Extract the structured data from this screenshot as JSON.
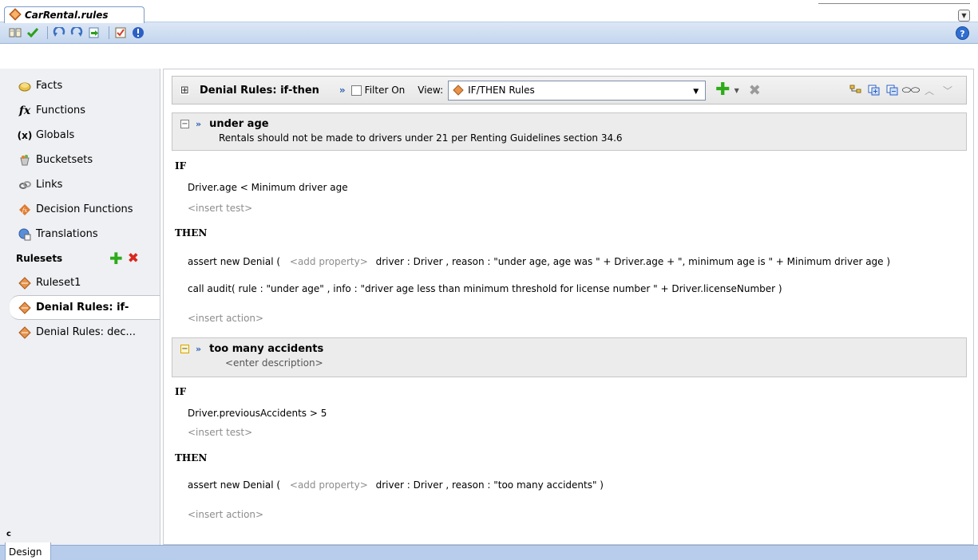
{
  "file_tab": {
    "label": "CarRental.rules"
  },
  "toolbar": {
    "icons": [
      "book-icon",
      "validate-check-icon",
      "undo-icon",
      "redo-icon",
      "import-icon",
      "report-icon",
      "info-icon"
    ],
    "help_label": "?"
  },
  "sidebar": {
    "items": [
      {
        "label": "Facts",
        "icon": "facts-icon"
      },
      {
        "label": "Functions",
        "icon": "functions-icon"
      },
      {
        "label": "Globals",
        "icon": "globals-icon"
      },
      {
        "label": "Bucketsets",
        "icon": "bucketsets-icon"
      },
      {
        "label": "Links",
        "icon": "links-icon"
      },
      {
        "label": "Decision Functions",
        "icon": "decision-functions-icon"
      },
      {
        "label": "Translations",
        "icon": "translations-icon"
      }
    ],
    "rulesets_header": "Rulesets",
    "rulesets": [
      {
        "label": "Ruleset1",
        "selected": false
      },
      {
        "label": "Denial Rules: if-",
        "selected": true
      },
      {
        "label": "Denial Rules: dec...",
        "selected": false
      }
    ],
    "collapse_glyph": "ⅽ"
  },
  "ruleset_header": {
    "toggle": "⊞",
    "title": "Denial Rules: if-then",
    "filter_label": "Filter On",
    "view_label": "View:",
    "view_value": "IF/THEN Rules"
  },
  "rules": [
    {
      "name": "under age",
      "description": "Rentals should not be made to drivers under 21 per Renting Guidelines section 34.6",
      "if_keyword": "IF",
      "tests": [
        "Driver.age  <  Minimum driver age"
      ],
      "insert_test": "<insert test>",
      "then_keyword": "THEN",
      "actions": [
        {
          "prefix": "assert new Denial (",
          "placeholder": "<add property>",
          "rest": "driver : Driver , reason : \"under age, age was \" + Driver.age + \", minimum age is \" + Minimum driver age  )"
        },
        {
          "prefix": "call audit( rule : \"under age\" , info : \"driver age less than minimum threshold for license number \" + Driver.licenseNumber )",
          "placeholder": "",
          "rest": ""
        }
      ],
      "insert_action": "<insert action>"
    },
    {
      "name": "too many accidents",
      "description": "<enter description>",
      "if_keyword": "IF",
      "tests": [
        "Driver.previousAccidents  >  5"
      ],
      "insert_test": "<insert test>",
      "then_keyword": "THEN",
      "actions": [
        {
          "prefix": "assert new Denial (",
          "placeholder": "<add property>",
          "rest": "driver : Driver , reason : \"too many accidents\"  )"
        }
      ],
      "insert_action": "<insert action>"
    }
  ],
  "bottom_tabs": {
    "design_label": "Design"
  }
}
